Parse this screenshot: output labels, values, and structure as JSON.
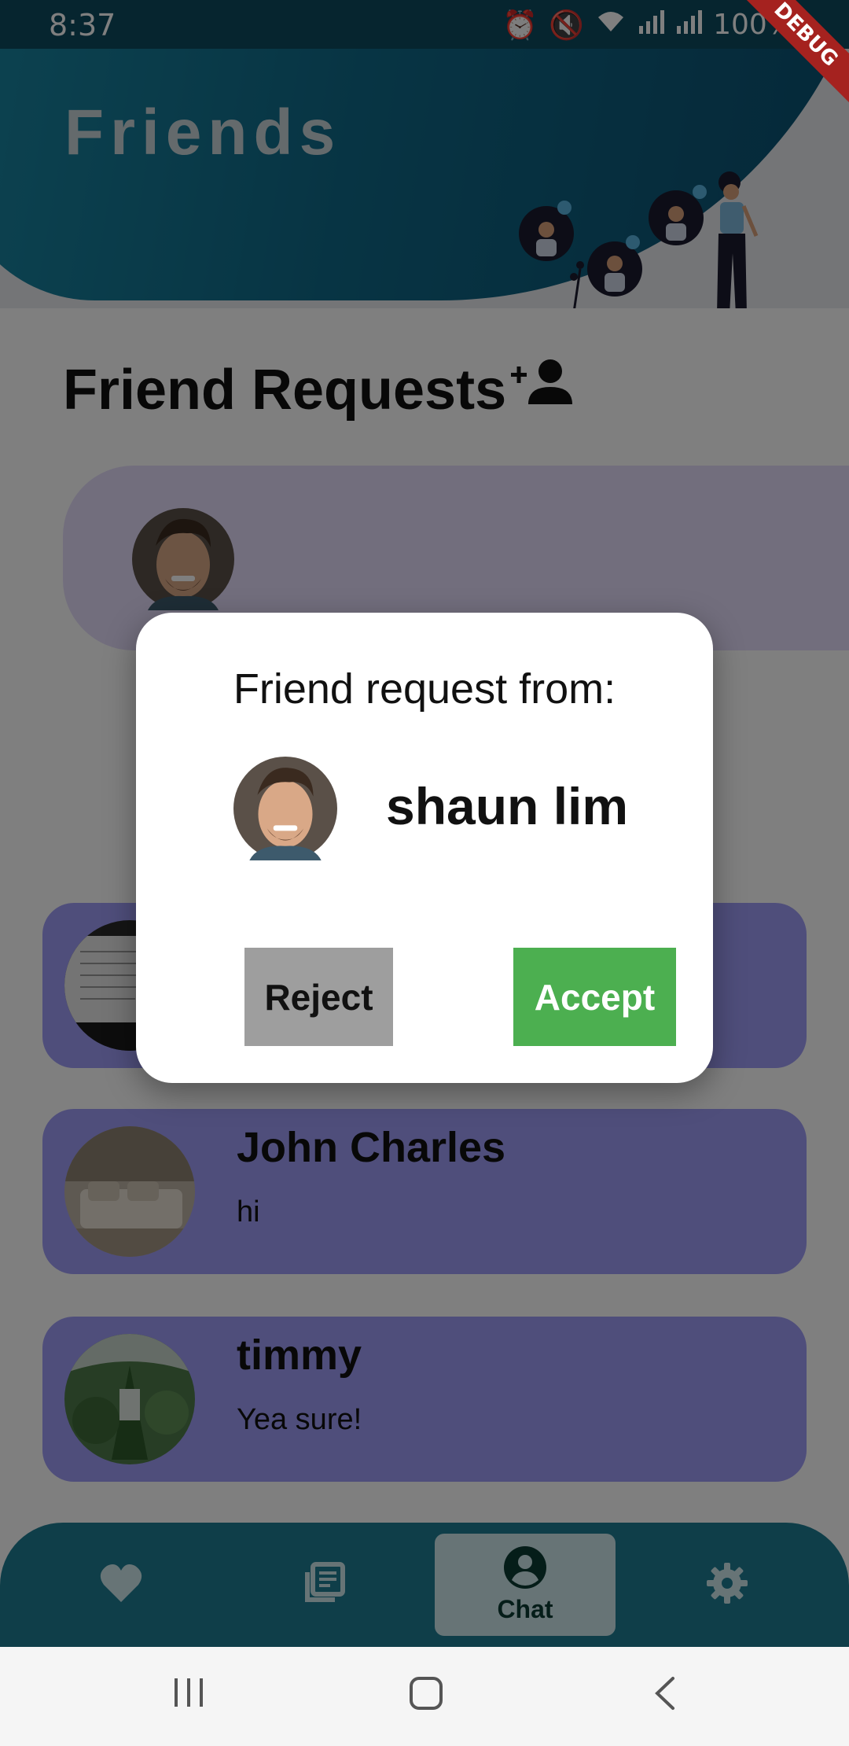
{
  "status_bar": {
    "time": "8:37",
    "battery": "100%",
    "debug_label": "DEBUG"
  },
  "header": {
    "title": "Friends"
  },
  "friend_requests": {
    "title": "Friend Requests"
  },
  "chats": [
    {
      "name": "",
      "message": ""
    },
    {
      "name": "John Charles",
      "message": "hi"
    },
    {
      "name": "timmy",
      "message": "Yea sure!"
    }
  ],
  "dialog": {
    "title": "Friend request from:",
    "name": "shaun lim",
    "reject_label": "Reject",
    "accept_label": "Accept"
  },
  "bottom_nav": {
    "items": [
      {
        "icon": "heart-icon",
        "label": ""
      },
      {
        "icon": "library-icon",
        "label": ""
      },
      {
        "icon": "account-circle-icon",
        "label": "Chat"
      },
      {
        "icon": "gear-icon",
        "label": ""
      }
    ],
    "active_index": 2
  },
  "colors": {
    "header_gradient_start": "#1b8aa5",
    "header_gradient_end": "#0a4f70",
    "request_card": "#e4dcfb",
    "chat_card": "#9f9cf6",
    "nav_bar": "#1f7d93",
    "accept": "#4caf50",
    "reject": "#9e9e9e"
  }
}
